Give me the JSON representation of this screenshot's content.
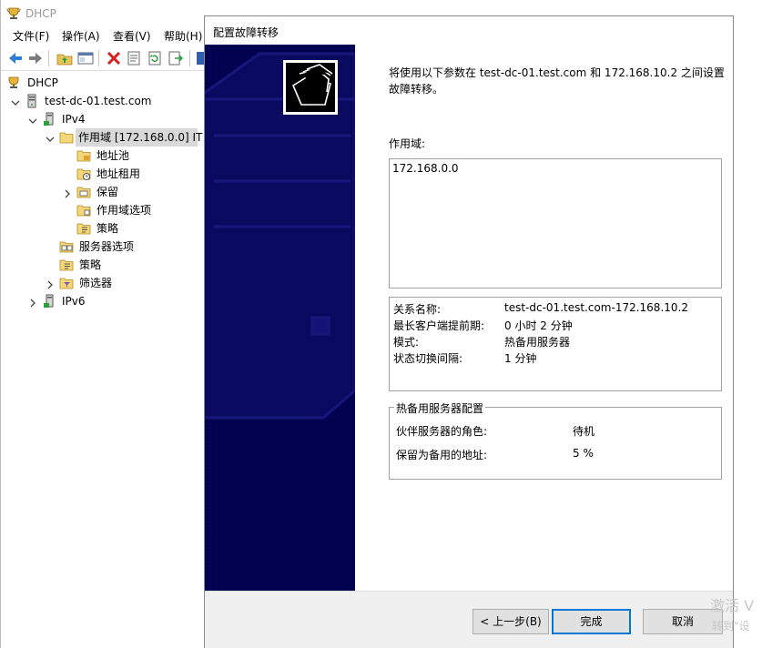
{
  "window": {
    "title": "DHCP"
  },
  "menu": [
    {
      "label": "文件(F)"
    },
    {
      "label": "操作(A)"
    },
    {
      "label": "查看(V)"
    },
    {
      "label": "帮助(H)"
    }
  ],
  "toolbar": {
    "icons": [
      "back-arrow-icon",
      "forward-arrow-icon",
      "up-folder-icon",
      "console-tree-icon",
      "delete-icon",
      "properties-icon",
      "refresh-icon",
      "export-icon",
      "help-icon"
    ]
  },
  "tree": {
    "root": "DHCP",
    "server": "test-dc-01.test.com",
    "ipv4": "IPv4",
    "scope": "作用域 [172.168.0.0] IT",
    "address_pool": "地址池",
    "address_leases": "地址租用",
    "reservations": "保留",
    "scope_options": "作用域选项",
    "scope_policies": "策略",
    "server_options": "服务器选项",
    "policies": "策略",
    "filters": "筛选器",
    "ipv6": "IPv6"
  },
  "wizard": {
    "title": "配置故障转移",
    "intro": "将使用以下参数在 test-dc-01.test.com 和 172.168.10.2 之间设置故障转移。",
    "scope_label": "作用域:",
    "scope_value": "172.168.0.0",
    "summary": {
      "relationship_name_label": "关系名称:",
      "relationship_name_value": "test-dc-01.test.com-172.168.10.2",
      "mclt_label": "最长客户端提前期:",
      "mclt_value": "0 小时 2 分钟",
      "mode_label": "模式:",
      "mode_value": "热备用服务器",
      "state_switchover_label": "状态切换间隔:",
      "state_switchover_value": "1 分钟"
    },
    "hot_standby": {
      "legend": "热备用服务器配置",
      "partner_role_label": "伙伴服务器的角色:",
      "partner_role_value": "待机",
      "reserve_label": "保留为备用的地址:",
      "reserve_value": "5 %"
    },
    "buttons": {
      "back": "< 上一步(B)",
      "finish": "完成",
      "cancel": "取消"
    }
  },
  "watermark": {
    "line1": "激活 V",
    "line2": "转到\"设"
  },
  "colors": {
    "side_panel": "#00004f",
    "accent": "#0078d7",
    "selection": "#d9d9d9"
  }
}
